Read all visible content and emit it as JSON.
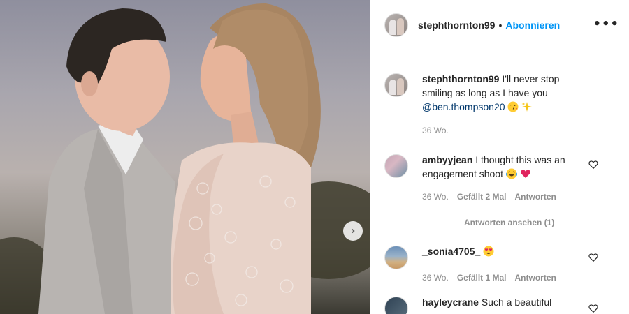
{
  "header": {
    "username": "stephthornton99",
    "separator": "•",
    "follow_label": "Abonnieren",
    "more_icon": "more-options-icon",
    "more_glyph": "•••"
  },
  "caption": {
    "username": "stephthornton99",
    "text": "I'll never stop smiling as long as I have you",
    "mention": "@ben.thompson20",
    "emojis": [
      "winking-kiss-emoji",
      "sparkles-emoji"
    ],
    "time": "36 Wo."
  },
  "comments": [
    {
      "username": "ambyyjean",
      "text": "I thought this was an engagement shoot",
      "emojis": [
        "crying-laughing-emoji",
        "red-heart-emoji"
      ],
      "time": "36 Wo.",
      "likes": "Gefällt 2 Mal",
      "reply": "Antworten",
      "view_replies": "Antworten ansehen (1)"
    },
    {
      "username": "_sonia4705_",
      "text": "",
      "emojis": [
        "heart-eyes-emoji"
      ],
      "time": "36 Wo.",
      "likes": "Gefällt 1 Mal",
      "reply": "Antworten"
    },
    {
      "username": "hayleycrane",
      "text": "Such a beautiful"
    }
  ],
  "carousel": {
    "next_icon": "chevron-right-icon",
    "next_glyph": "›"
  },
  "colors": {
    "accent": "#0095f6",
    "mention": "#00376b",
    "muted": "#8e8e8e"
  }
}
